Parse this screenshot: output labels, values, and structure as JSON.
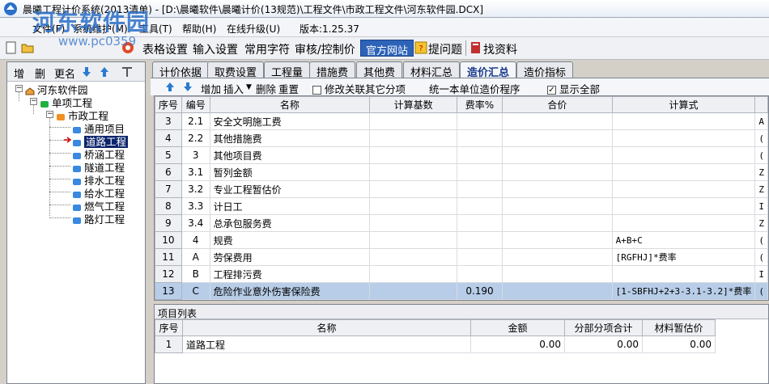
{
  "window": {
    "title": "晨曦工程计价系统(2013清单) - [D:\\晨曦软件\\晨曦计价(13规范)\\工程文件\\市政工程文件\\河东软件园.DCX]"
  },
  "watermark": {
    "line1": "河东软件园",
    "line2": "www.pc0359"
  },
  "menu": {
    "items": [
      "文件(F)",
      "系统维护(M)",
      "工具(T)",
      "帮助(H)",
      "在线升级(U)",
      "版本:1.25.37"
    ]
  },
  "toolbar": {
    "items": [
      "表格设置",
      "输入设置",
      "常用字符",
      "审核/控制价"
    ],
    "official_site": "官方网站",
    "ask": "提问题",
    "find_docs": "找资料"
  },
  "left_toolbar": {
    "add": "增",
    "delete": "删",
    "rename": "更名"
  },
  "tree": {
    "root": "河东软件园",
    "level1": "单项工程",
    "level2": "市政工程",
    "leaves": [
      "通用项目",
      "道路工程",
      "桥涵工程",
      "隧道工程",
      "排水工程",
      "给水工程",
      "燃气工程",
      "路灯工程"
    ],
    "selected_index": 1
  },
  "tabs": [
    "计价依据",
    "取费设置",
    "工程量",
    "措施费",
    "其他费",
    "材料汇总",
    "造价汇总",
    "造价指标"
  ],
  "active_tab": 6,
  "actions": {
    "add": "增加",
    "insert": "插入",
    "delete": "删除",
    "renumber": "重置",
    "modify_other": "修改关联其它分项",
    "unify": "统一本单位造价程序",
    "show_all": "显示全部"
  },
  "grid": {
    "headers": [
      "序号",
      "编号",
      "名称",
      "计算基数",
      "费率%",
      "合价",
      "计算式"
    ],
    "rows": [
      {
        "no": "3",
        "code": "2.1",
        "name": "安全文明施工费",
        "base": "",
        "rate": "",
        "total": "",
        "formula": "",
        "extra": "A"
      },
      {
        "no": "4",
        "code": "2.2",
        "name": "其他措施费",
        "base": "",
        "rate": "",
        "total": "",
        "formula": "",
        "extra": "("
      },
      {
        "no": "5",
        "code": "3",
        "name": "其他项目费",
        "base": "",
        "rate": "",
        "total": "",
        "formula": "",
        "extra": "("
      },
      {
        "no": "6",
        "code": "3.1",
        "name": "暂列金额",
        "base": "",
        "rate": "",
        "total": "",
        "formula": "",
        "extra": "Z"
      },
      {
        "no": "7",
        "code": "3.2",
        "name": "专业工程暂估价",
        "base": "",
        "rate": "",
        "total": "",
        "formula": "",
        "extra": "Z"
      },
      {
        "no": "8",
        "code": "3.3",
        "name": "计日工",
        "base": "",
        "rate": "",
        "total": "",
        "formula": "",
        "extra": "I"
      },
      {
        "no": "9",
        "code": "3.4",
        "name": "总承包服务费",
        "base": "",
        "rate": "",
        "total": "",
        "formula": "",
        "extra": "Z"
      },
      {
        "no": "10",
        "code": "4",
        "name": "规费",
        "base": "",
        "rate": "",
        "total": "",
        "formula": "A+B+C",
        "extra": "("
      },
      {
        "no": "11",
        "code": "A",
        "name": "劳保费用",
        "base": "",
        "rate": "",
        "total": "",
        "formula": "[RGFHJ]*费率",
        "extra": "("
      },
      {
        "no": "12",
        "code": "B",
        "name": "工程排污费",
        "base": "",
        "rate": "",
        "total": "",
        "formula": "",
        "extra": "I"
      },
      {
        "no": "13",
        "code": "C",
        "name": "危险作业意外伤害保险费",
        "base": "",
        "rate": "0.190",
        "total": "",
        "formula": "[1-SBFHJ+2+3-3.1-3.2]*费率",
        "extra": "("
      }
    ],
    "selected_row": 10
  },
  "project_list": {
    "title": "项目列表",
    "headers": [
      "序号",
      "名称",
      "金额",
      "分部分项合计",
      "材料暂估价"
    ],
    "rows": [
      {
        "no": "1",
        "name": "道路工程",
        "amount": "0.00",
        "subtotal": "0.00",
        "material": "0.00"
      }
    ]
  }
}
